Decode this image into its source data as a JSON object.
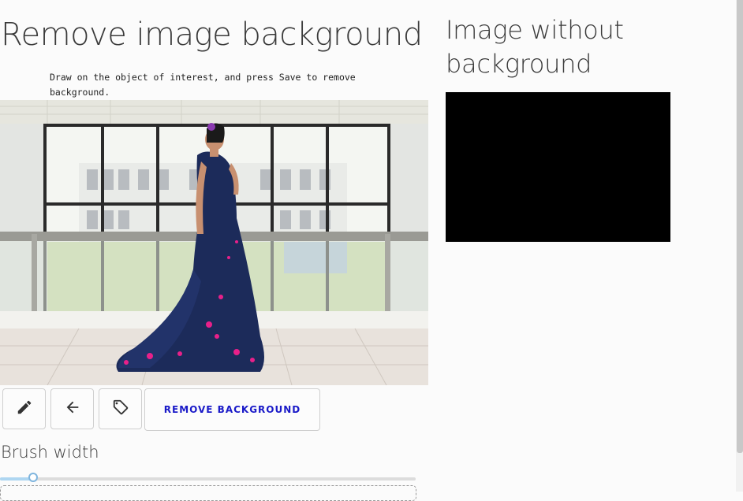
{
  "editor": {
    "title": "Remove image background",
    "instructions": "Draw on the object of interest, and press Save to remove background.",
    "toolbar": {
      "pencil_icon": "pencil-icon",
      "undo_icon": "arrow-left-icon",
      "label_icon": "tag-icon",
      "remove_label": "REMOVE BACKGROUND"
    },
    "brush": {
      "label": "Brush width",
      "value_fraction": 0.08
    }
  },
  "result": {
    "title": "Image without background"
  },
  "colors": {
    "accent": "#1a1ac8",
    "result_background": "#000000",
    "slider_fill": "#aed6f1"
  }
}
